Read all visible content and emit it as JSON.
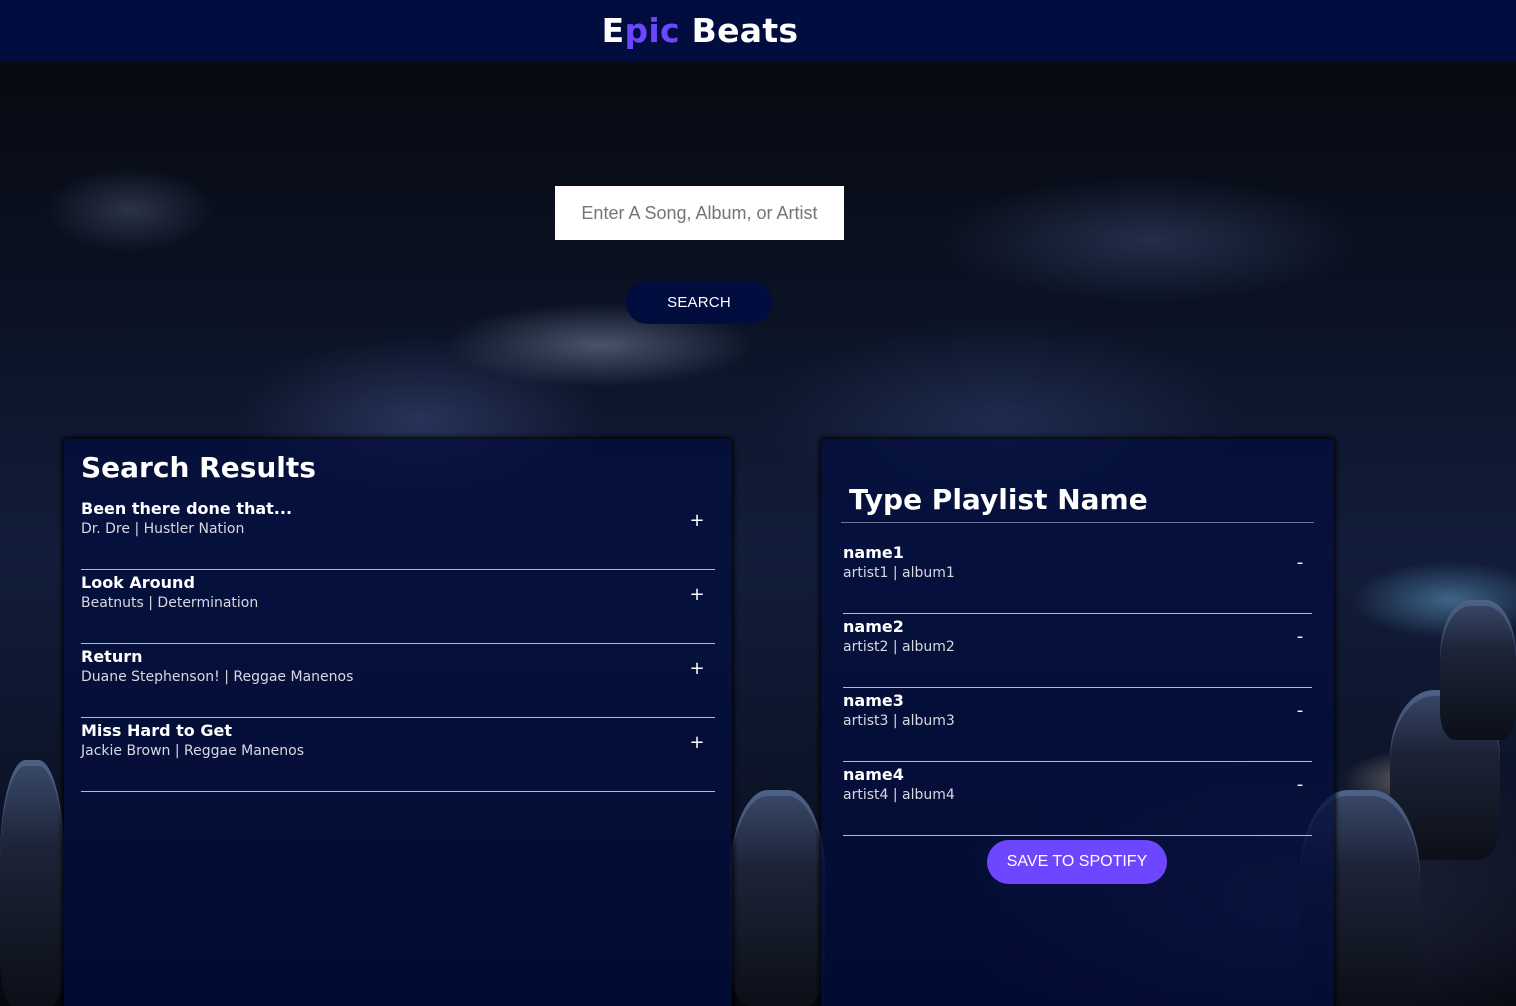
{
  "header": {
    "brand_e": "E",
    "brand_pic": "pic",
    "brand_rest": " Beats",
    "accent_color": "#6c47ff",
    "bar_color": "#010c3f"
  },
  "search": {
    "placeholder": "Enter A Song, Album, or Artist",
    "button_label": "SEARCH"
  },
  "results": {
    "title": "Search Results",
    "add_symbol": "+",
    "tracks": [
      {
        "name": "Been there done that...",
        "meta": "Dr. Dre | Hustler Nation"
      },
      {
        "name": "Look Around",
        "meta": "Beatnuts | Determination"
      },
      {
        "name": "Return",
        "meta": "Duane Stephenson! | Reggae Manenos"
      },
      {
        "name": "Miss Hard to Get",
        "meta": "Jackie Brown | Reggae Manenos"
      }
    ]
  },
  "playlist": {
    "name_value": "Type Playlist Name",
    "remove_symbol": "-",
    "tracks": [
      {
        "name": "name1",
        "meta": "artist1 | album1"
      },
      {
        "name": "name2",
        "meta": "artist2 | album2"
      },
      {
        "name": "name3",
        "meta": "artist3 | album3"
      },
      {
        "name": "name4",
        "meta": "artist4 | album4"
      }
    ],
    "save_label": "SAVE TO SPOTIFY"
  }
}
